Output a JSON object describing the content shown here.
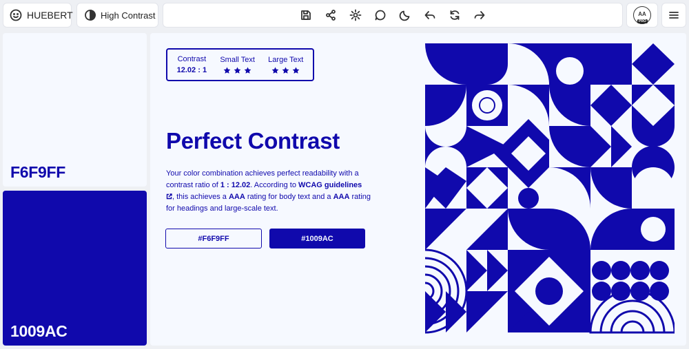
{
  "app": {
    "brand": "HUEBERT",
    "mode_label": "High Contrast"
  },
  "toolbar": {
    "icons": [
      "save-icon",
      "share-icon",
      "settings-icon",
      "comment-icon",
      "dark-mode-icon",
      "undo-icon",
      "refresh-icon",
      "redo-icon"
    ],
    "aa_label": "AA",
    "aa_badge": "PRO"
  },
  "swatches": [
    {
      "hex": "F6F9FF",
      "color": "#F6F9FF"
    },
    {
      "hex": "1009AC",
      "color": "#1009AC"
    }
  ],
  "score": {
    "contrast_label": "Contrast",
    "contrast_value": "12.02 : 1",
    "small_label": "Small Text",
    "large_label": "Large Text",
    "small_stars": 3,
    "large_stars": 3
  },
  "main": {
    "title": "Perfect Contrast",
    "desc_1": "Your color combination achieves perfect readability with a contrast ratio of ",
    "ratio": "1 : 12.02",
    "desc_2": ". According to ",
    "wcag": "WCAG guidelines",
    "desc_3": ", this achieves a ",
    "aaa1": "AAA",
    "desc_4": " rating for body text and a ",
    "aaa2": "AAA",
    "desc_5": " rating for headings and large-scale text."
  },
  "buttons": {
    "light": "#F6F9FF",
    "dark": "#1009AC"
  },
  "colors": {
    "accent": "#1009AC",
    "background": "#F6F9FF"
  }
}
